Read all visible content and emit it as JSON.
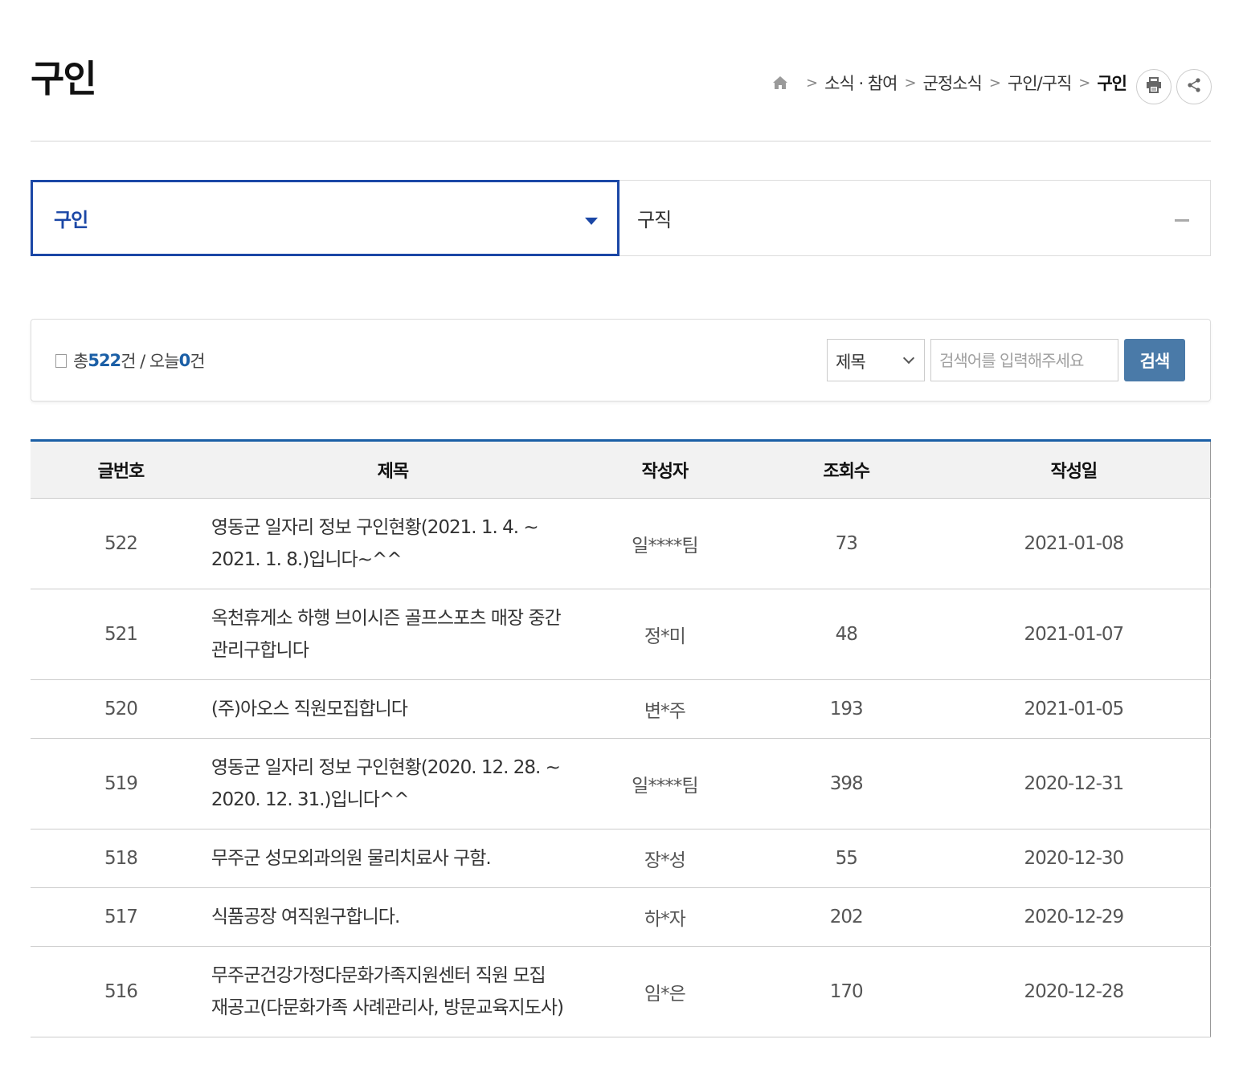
{
  "page_title": "구인",
  "breadcrumb": {
    "home_icon": "home-icon",
    "items": [
      "소식 · 참여",
      "군정소식",
      "구인/구직"
    ],
    "current": "구인"
  },
  "actions": {
    "print_icon": "print-icon",
    "share_icon": "share-icon"
  },
  "tabs": [
    {
      "label": "구인",
      "active": true
    },
    {
      "label": "구직",
      "active": false
    }
  ],
  "search": {
    "total_prefix": "총 ",
    "total": "522",
    "total_suffix": "건 / 오늘 ",
    "today": "0",
    "today_suffix": "건",
    "field_selected": "제목",
    "placeholder": "검색어를 입력해주세요",
    "button_label": "검색"
  },
  "table": {
    "headers": [
      "글번호",
      "제목",
      "작성자",
      "조회수",
      "작성일"
    ],
    "rows": [
      {
        "no": "522",
        "title": "영동군 일자리 정보 구인현황(2021. 1. 4. ~ 2021. 1. 8.)입니다~^^",
        "author": "일****팀",
        "views": "73",
        "date": "2021-01-08"
      },
      {
        "no": "521",
        "title": "옥천휴게소 하행 브이시즌 골프스포츠 매장 중간관리구합니다",
        "author": "정*미",
        "views": "48",
        "date": "2021-01-07"
      },
      {
        "no": "520",
        "title": "(주)아오스 직원모집합니다",
        "author": "변*주",
        "views": "193",
        "date": "2021-01-05"
      },
      {
        "no": "519",
        "title": "영동군 일자리 정보 구인현황(2020. 12. 28. ~ 2020. 12. 31.)입니다^^",
        "author": "일****팀",
        "views": "398",
        "date": "2020-12-31"
      },
      {
        "no": "518",
        "title": "무주군 성모외과의원 물리치료사 구함.",
        "author": "장*성",
        "views": "55",
        "date": "2020-12-30"
      },
      {
        "no": "517",
        "title": "식품공장 여직원구합니다.",
        "author": "하*자",
        "views": "202",
        "date": "2020-12-29"
      },
      {
        "no": "516",
        "title": "무주군건강가정다문화가족지원센터 직원 모집 재공고(다문화가족 사례관리사, 방문교육지도사)",
        "author": "임*은",
        "views": "170",
        "date": "2020-12-28"
      }
    ]
  }
}
